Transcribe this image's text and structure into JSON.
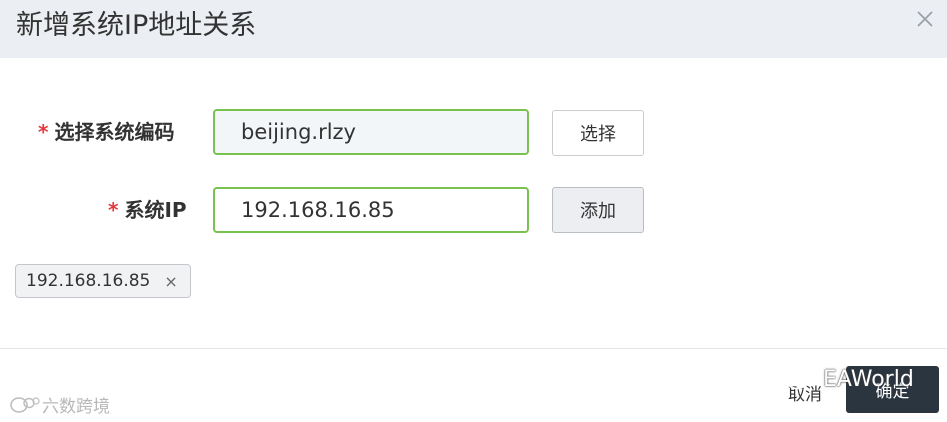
{
  "dialog": {
    "title": "新增系统IP地址关系"
  },
  "form": {
    "system_code": {
      "required_mark": "*",
      "label": "选择系统编码",
      "value": "beijing.rlzy",
      "button_label": "选择"
    },
    "system_ip": {
      "required_mark": "*",
      "label": "系统IP",
      "value": "192.168.16.85",
      "button_label": "添加"
    }
  },
  "ip_tags": [
    {
      "label": "192.168.16.85",
      "remove_icon": "×"
    }
  ],
  "footer": {
    "cancel_label": "取消",
    "confirm_label": "确定"
  },
  "watermarks": {
    "left": "六数跨境",
    "right": "EAWorld"
  },
  "colors": {
    "header_bg": "#ebeef2",
    "input_border": "#7ac250",
    "required": "#e4393c",
    "confirm_bg": "#2a3540"
  }
}
